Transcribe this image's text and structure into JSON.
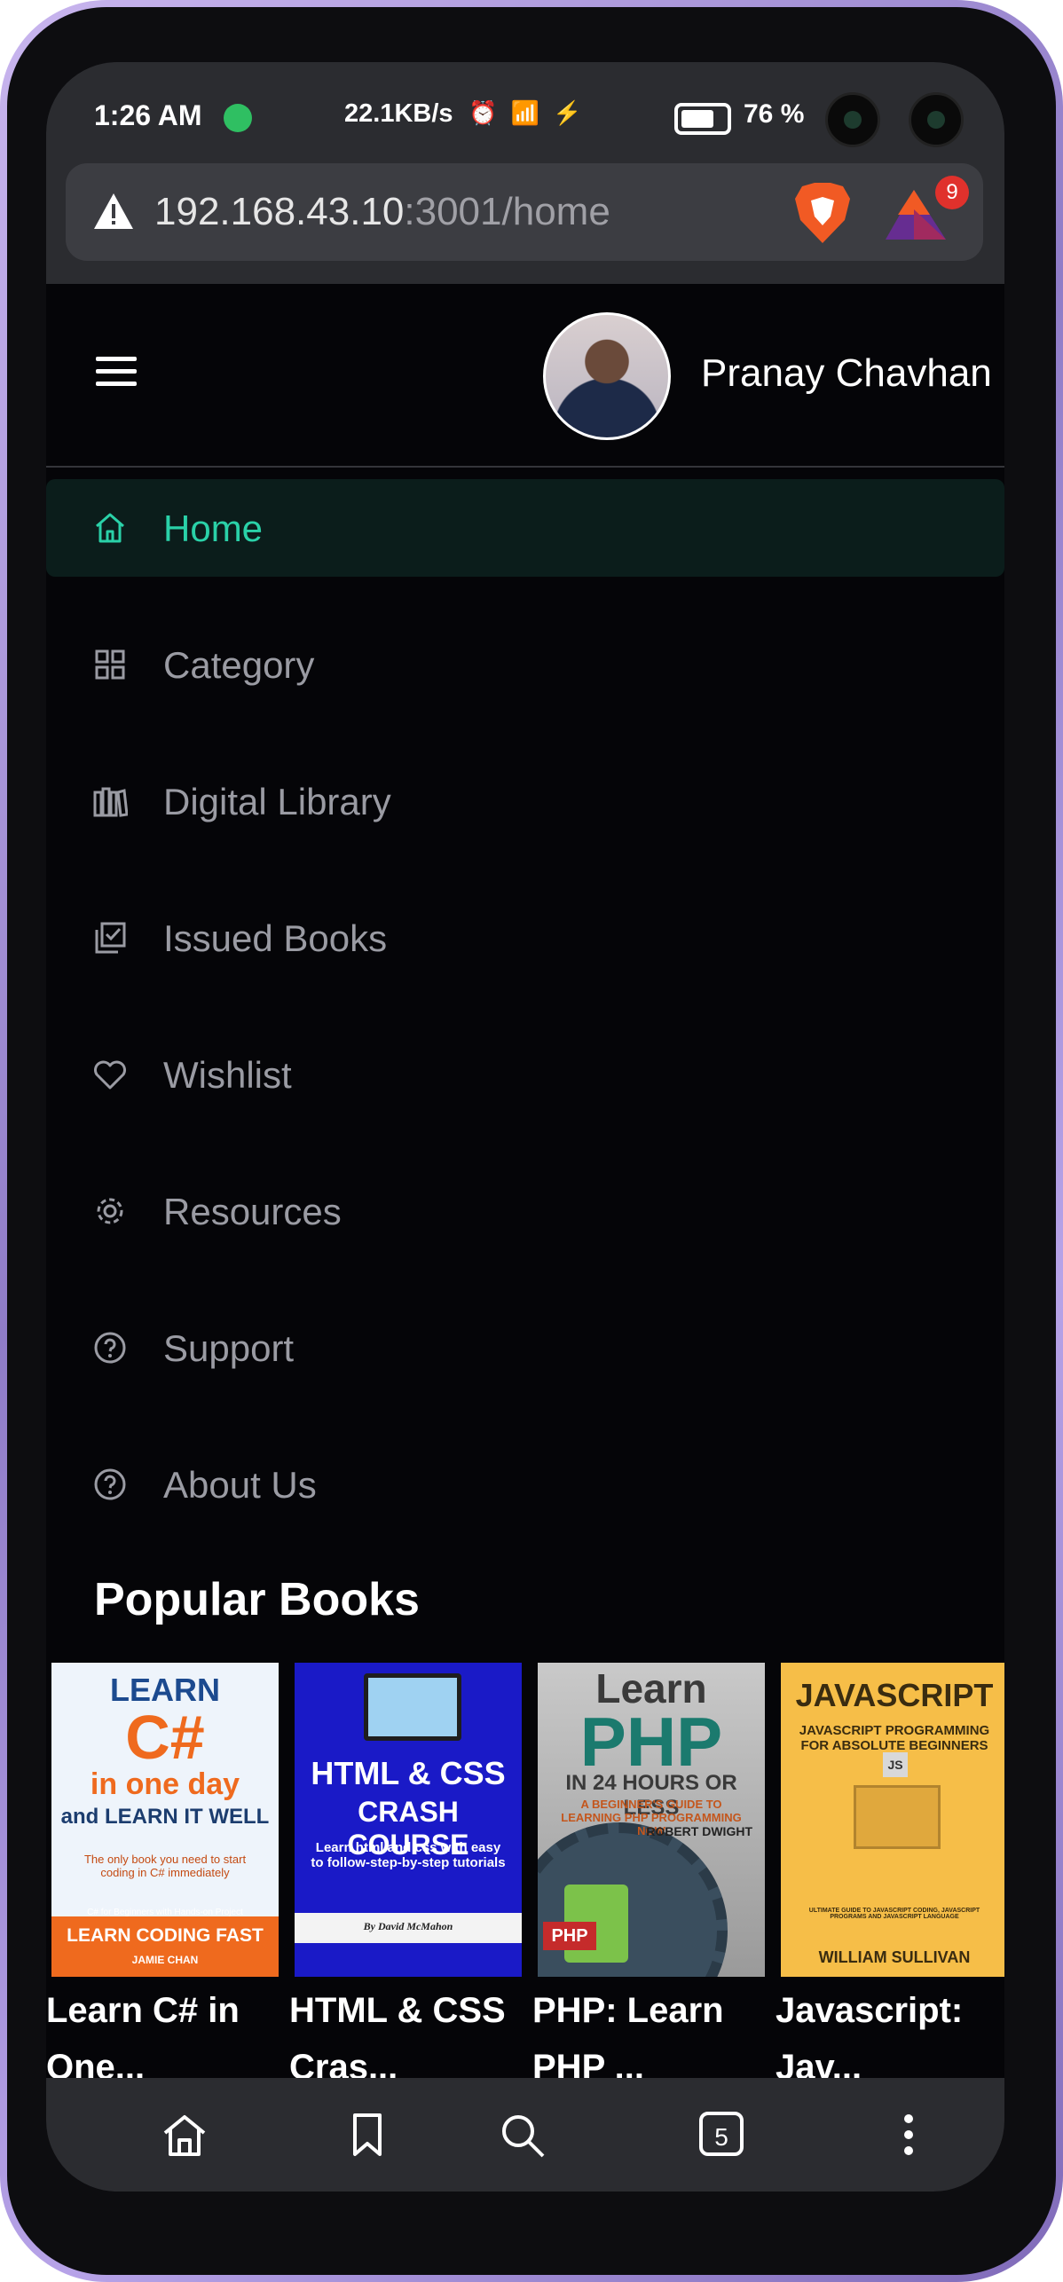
{
  "status_bar": {
    "time": "1:26 AM",
    "net_speed": "22.1KB/s",
    "extra_icons": "⏰ 📶 ⚡",
    "battery_pct": "76 %"
  },
  "browser": {
    "url_host": "192.168.43.10",
    "url_path": ":3001/home",
    "rewards_badge": "9",
    "tab_count": "5"
  },
  "header": {
    "user_name": "Pranay Chavhan"
  },
  "nav": {
    "items": [
      {
        "label": "Home",
        "icon": "home-icon",
        "active": true
      },
      {
        "label": "Category",
        "icon": "grid-icon",
        "active": false
      },
      {
        "label": "Digital Library",
        "icon": "library-icon",
        "active": false
      },
      {
        "label": "Issued Books",
        "icon": "issued-icon",
        "active": false
      },
      {
        "label": "Wishlist",
        "icon": "heart-icon",
        "active": false
      },
      {
        "label": "Resources",
        "icon": "gear-icon",
        "active": false
      },
      {
        "label": "Support",
        "icon": "help-icon",
        "active": false
      },
      {
        "label": "About Us",
        "icon": "help-icon",
        "active": false
      }
    ]
  },
  "popular": {
    "title": "Popular Books",
    "books": [
      {
        "title": "Learn C# in One...",
        "cover": {
          "line1": "LEARN",
          "line2": "C#",
          "line3": "in one day",
          "line4": "and LEARN IT WELL",
          "line5": "The only book you need to start coding in C# immediately",
          "band": "LEARN CODING FAST",
          "author": "JAMIE CHAN",
          "band_sub": "C# for Beginners with Hands-on Project"
        }
      },
      {
        "title": "HTML & CSS Cras...",
        "cover": {
          "line1": "HTML & CSS",
          "line2": "CRASH COURSE",
          "line3": "Learn html and css with easy to follow-step-by-step tutorials",
          "author": "By David McMahon"
        }
      },
      {
        "title": "PHP: Learn PHP ...",
        "cover": {
          "line1": "Learn",
          "line2": "PHP",
          "line3": "IN 24 HOURS OR LESS",
          "line4": "A BEGINNER'S GUIDE TO LEARNING PHP PROGRAMMING NOW",
          "author": "ROBERT DWIGHT",
          "badge": "PHP"
        }
      },
      {
        "title": "Javascript: Jav...",
        "cover": {
          "line1": "JAVASCRIPT",
          "line2": "JAVASCRIPT PROGRAMMING FOR ABSOLUTE BEGINNERS",
          "line3": "ULTIMATE GUIDE TO JAVASCRIPT CODING, JAVASCRIPT PROGRAMS AND JAVASCRIPT LANGUAGE",
          "author": "WILLIAM SULLIVAN",
          "badge": "JS"
        }
      }
    ]
  },
  "colors": {
    "accent": "#2ad1a8",
    "background": "#050508",
    "browser_chrome": "#2b2c30"
  }
}
